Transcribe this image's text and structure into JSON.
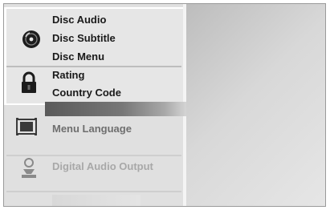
{
  "menu": {
    "disc_group": {
      "icon": "disc-icon",
      "items": [
        "Disc Audio",
        "Disc Subtitle",
        "Disc Menu"
      ]
    },
    "lock_group": {
      "icon": "lock-icon",
      "items": [
        "Rating",
        "Country Code"
      ]
    },
    "language_group": {
      "icon": "tv-screen-icon",
      "items": [
        "Menu Language"
      ]
    },
    "audio_group": {
      "icon": "speaker-icon",
      "items": [
        "Digital Audio Output"
      ]
    }
  },
  "colors": {
    "menu_bg": "#e0e0e0",
    "text": "#1a1a1a",
    "dim_text": "#a8a8a8",
    "highlight": "#5a5a5a"
  }
}
